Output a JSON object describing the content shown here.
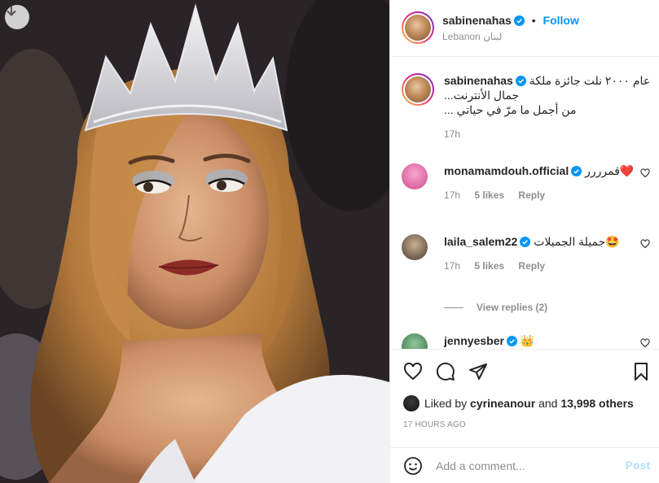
{
  "post": {
    "download_icon": "arrow-down-icon",
    "photo_description_icon": "photo"
  },
  "header": {
    "username": "sabinenahas",
    "separator": "•",
    "follow_label": "Follow",
    "location": "Lebanon لبنان"
  },
  "caption": {
    "username": "sabinenahas",
    "line1": "عام ٢٠٠٠ نلت جائزة ملكة",
    "line2": "جمال الأنترنت...",
    "line3": "من أجمل ما مرّ في حياتي ...",
    "time": "17h"
  },
  "comments": [
    {
      "username": "monamamdouh.official",
      "text": "قمرررر❤️",
      "time": "17h",
      "likes": "5 likes",
      "reply": "Reply"
    },
    {
      "username": "laila_salem22",
      "text": "جميلة الجميلات🤩",
      "time": "17h",
      "likes": "5 likes",
      "reply": "Reply"
    },
    {
      "username": "jennyesber",
      "text": "👑"
    }
  ],
  "view_replies": "View replies (2)",
  "likes": {
    "prefix": "Liked by ",
    "user": "cyrineanour",
    "middle": " and ",
    "count": "13,998 others"
  },
  "timestamp": "17 HOURS AGO",
  "add_comment": {
    "placeholder": "Add a comment...",
    "post_label": "Post"
  },
  "colors": {
    "accent": "#0095f6",
    "post_disabled": "#b2dffc",
    "muted": "#8e8e8e"
  }
}
